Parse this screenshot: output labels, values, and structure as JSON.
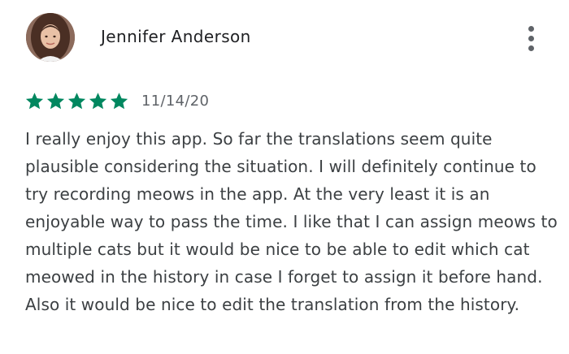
{
  "review": {
    "reviewer_name": "Jennifer Anderson",
    "rating": 5,
    "rating_max": 5,
    "date": "11/14/20",
    "text": "I really enjoy this app. So far the translations seem quite plausible considering the situation. I will definitely continue to try recording meows in the app. At the very least it is an enjoyable way to pass the time. I like that I can assign meows to multiple cats but it would be nice to be able to edit which cat meowed in the history in case I forget to assign it before hand. Also it would be nice to edit the translation from the history."
  },
  "icons": {
    "menu": "more-vert-icon",
    "star": "star-icon"
  },
  "colors": {
    "star": "#01875f",
    "name": "#202124",
    "body_text": "#3c4043",
    "secondary_text": "#5f6368"
  }
}
